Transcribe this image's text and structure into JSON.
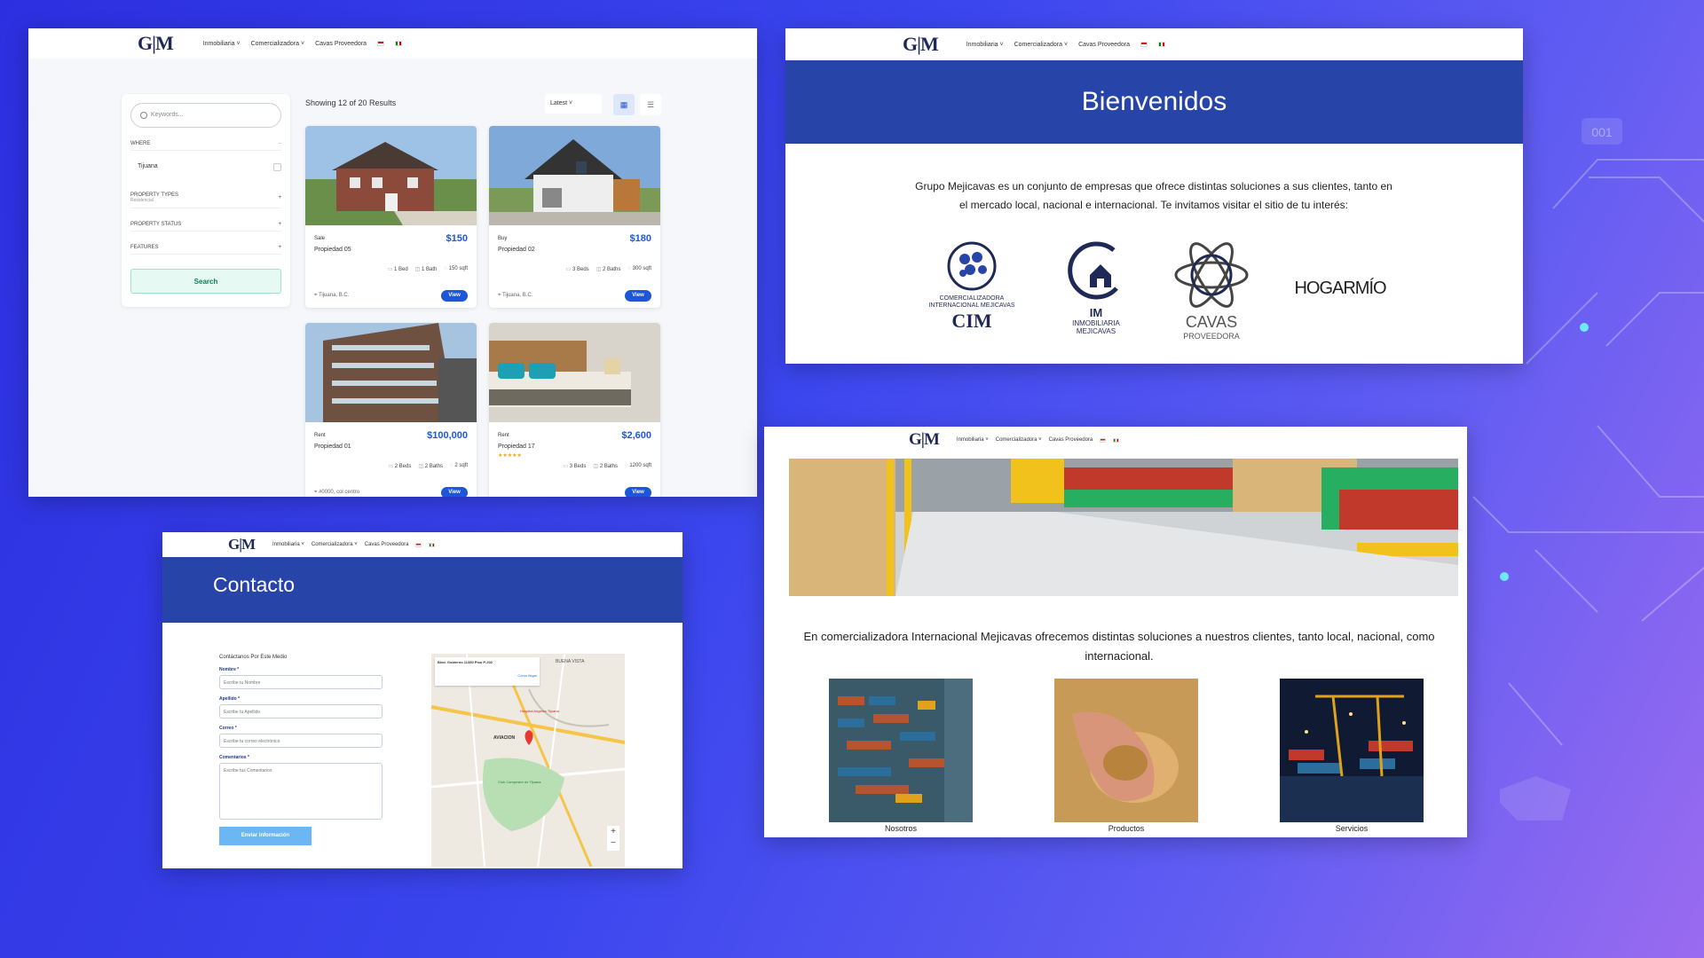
{
  "nav": {
    "logo": "G|M",
    "items": [
      "Inmobiliaria ˅",
      "Comercializadora ˅",
      "Cavas Proveedora"
    ]
  },
  "listing": {
    "search_placeholder": "Keywords...",
    "where_label": "WHERE",
    "where_value": "Tijuana",
    "property_types_label": "PROPERTY TYPES",
    "property_types_value": "Residencial",
    "property_status_label": "PROPERTY STATUS",
    "features_label": "FEATURES",
    "search_button": "Search",
    "results_text": "Showing 12 of 20 Results",
    "sort_value": "Latest ˅",
    "cards": [
      {
        "status": "Sale",
        "price": "$150",
        "name": "Propiedad 05",
        "stars": "",
        "beds": "1 Bed",
        "baths": "1 Bath",
        "area": "150 sqft",
        "location": "Tijuana, B.C.",
        "view": "View"
      },
      {
        "status": "Buy",
        "price": "$180",
        "name": "Propiedad 02",
        "stars": "",
        "beds": "3 Beds",
        "baths": "2 Baths",
        "area": "300 sqft",
        "location": "Tijuana, B.C.",
        "view": "View"
      },
      {
        "status": "Rent",
        "price": "$100,000",
        "name": "Propiedad 01",
        "stars": "",
        "beds": "2 Beds",
        "baths": "2 Baths",
        "area": "2 sqft",
        "location": "#0000, col centro",
        "view": "View"
      },
      {
        "status": "Rent",
        "price": "$2,600",
        "name": "Propiedad 17",
        "stars": "★★★★★",
        "beds": "3 Beds",
        "baths": "2 Baths",
        "area": "1200 sqft",
        "location": "",
        "view": "View"
      }
    ]
  },
  "welcome": {
    "title": "Bienvenidos",
    "intro": "Grupo Mejicavas es un conjunto de empresas que ofrece distintas soluciones a sus clientes, tanto en el mercado local, nacional e internacional. Te invitamos visitar el sitio de tu interés:",
    "brands": [
      {
        "line1": "COMERCIALIZADORA",
        "line2": "INTERNACIONAL MEJICAVAS",
        "mark": "CIM"
      },
      {
        "line1": "INMOBILIARIA",
        "line2": "MEJICAVAS",
        "mark": "IM"
      },
      {
        "line1": "CAVAS",
        "line2": "PROVEEDORA",
        "mark": ""
      },
      {
        "line1": "HOGARMÍO",
        "line2": "",
        "mark": ""
      }
    ]
  },
  "contact": {
    "title": "Contacto",
    "subtitle": "Contáctanos Por Este Medio",
    "fields": [
      {
        "label": "Nombre *",
        "placeholder": "Escribe tu Nombre"
      },
      {
        "label": "Apellido *",
        "placeholder": "Escribe tu Apellido"
      },
      {
        "label": "Correo *",
        "placeholder": "Escribe tu correo electrónico"
      }
    ],
    "comments_label": "Comentarios *",
    "comments_placeholder": "Escribe tus Comentarios",
    "submit": "Enviar información",
    "map": {
      "address_line1": "Blvd. Gobierno 11350 Piso P-202",
      "link": "Cómo llegar",
      "labels": [
        "BUENA VISTA",
        "AVIACION",
        "Club Campestre de Tijuana",
        "Hospital Angeles Tijuana"
      ]
    }
  },
  "trading": {
    "intro": "En comercializadora Internacional Mejicavas ofrecemos distintas soluciones a nuestros clientes, tanto local, nacional, como internacional.",
    "tiles": [
      "Nosotros",
      "Productos",
      "Servicios"
    ]
  },
  "decor": {
    "counter": "001"
  },
  "colors": {
    "primary": "#2744a8",
    "accent": "#1e56d9",
    "background": "#3b46ee"
  }
}
